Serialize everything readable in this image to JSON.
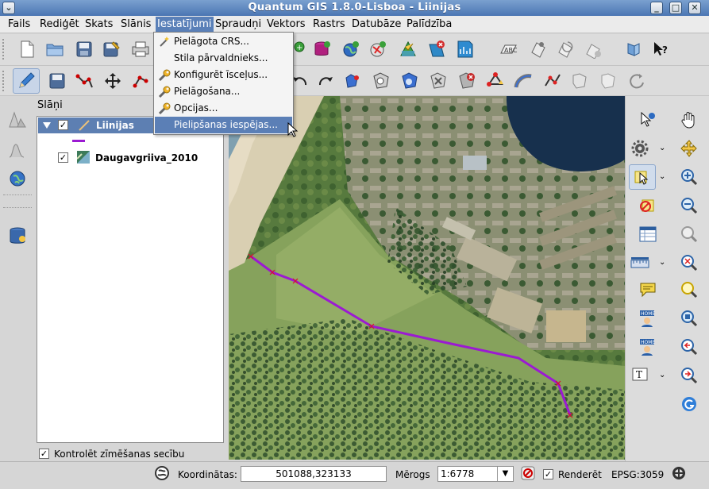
{
  "window": {
    "title": "Quantum GIS 1.8.0-Lisboa - Liinijas"
  },
  "menubar": {
    "items": [
      "Fails",
      "Rediģēt",
      "Skats",
      "Slānis",
      "Iestatījumi",
      "Spraudņi",
      "Vektors",
      "Rastrs",
      "Datubāze",
      "Palīdzība"
    ],
    "active_index": 4
  },
  "settings_menu": {
    "items": [
      {
        "label": "Pielāgota CRS...",
        "icon": "magic-wand-icon"
      },
      {
        "label": "Stila pārvaldnieks...",
        "icon": ""
      },
      {
        "label": "Konfigurēt īsceļus...",
        "icon": "wrench-icon"
      },
      {
        "label": "Pielāgošana...",
        "icon": "wrench-icon"
      },
      {
        "label": "Opcijas...",
        "icon": "wrench-icon"
      },
      {
        "label": "Pielipšanas iespējas...",
        "icon": ""
      }
    ],
    "highlighted_index": 5
  },
  "layers_panel": {
    "title": "Slāņi",
    "layers": [
      {
        "name": "Liinijas",
        "checked": true,
        "selected": true,
        "icon": "line-layer-icon",
        "line_color": "#9b1ad2"
      },
      {
        "name": "Daugavgriiva_2010",
        "checked": true,
        "selected": false,
        "icon": "raster-layer-icon"
      }
    ],
    "render_order_label": "Kontrolēt zīmēšanas secību",
    "render_order_checked": true
  },
  "statusbar": {
    "coordinates_label": "Koordinātas:",
    "coordinates_value": "501088,323133",
    "scale_label": "Mērogs",
    "scale_value": "1:6778",
    "render_label": "Renderēt",
    "render_checked": true,
    "crs_label": "EPSG:3059"
  },
  "colors": {
    "titlebar": "#5a82bb",
    "selection": "#5b7fb6",
    "line_feature": "#9b1ad2",
    "vertex_marker": "#d8102f"
  }
}
